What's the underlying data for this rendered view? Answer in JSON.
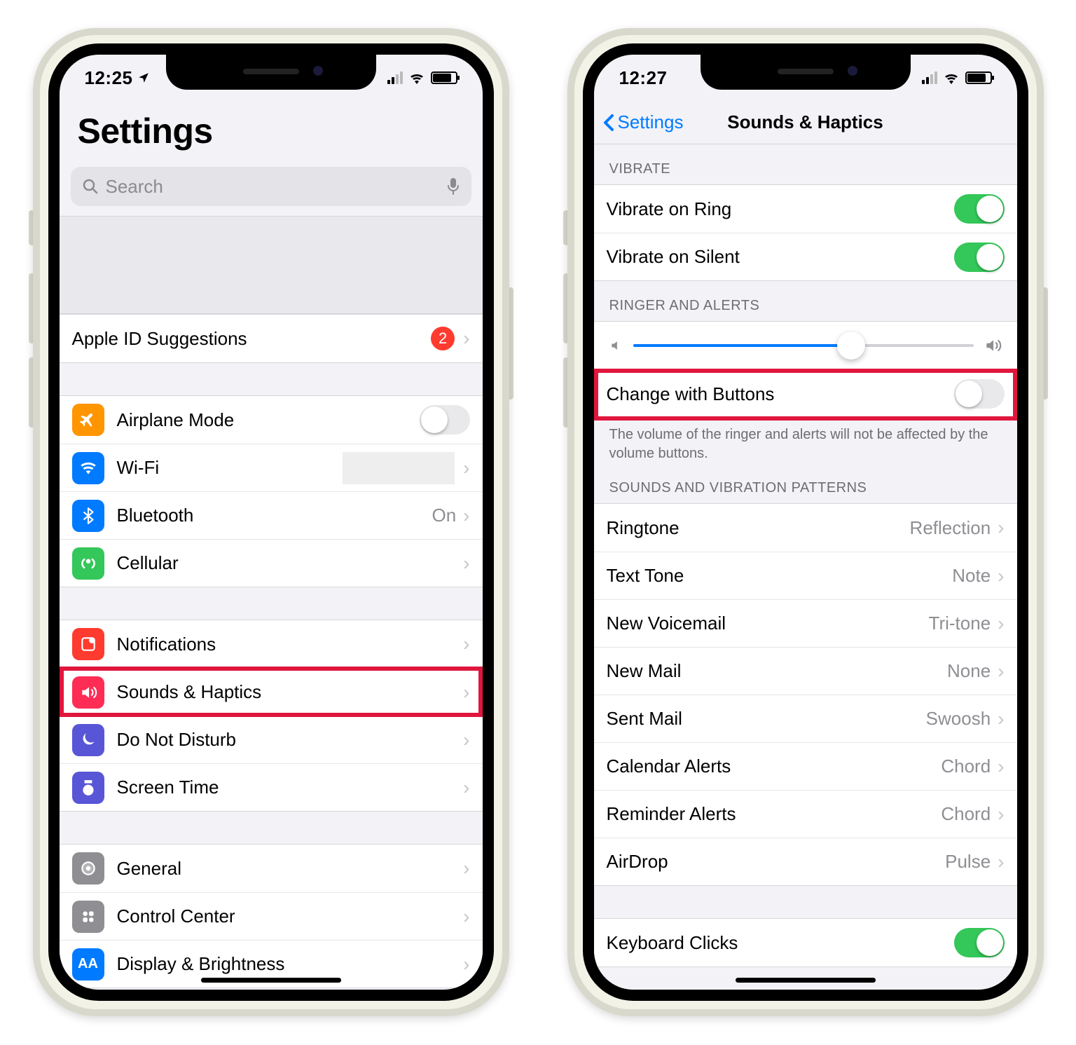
{
  "left": {
    "status_time": "12:25",
    "title": "Settings",
    "search_placeholder": "Search",
    "apple_id_row": {
      "label": "Apple ID Suggestions",
      "badge": "2"
    },
    "network": {
      "airplane": "Airplane Mode",
      "wifi": "Wi-Fi",
      "bluetooth": "Bluetooth",
      "bluetooth_value": "On",
      "cellular": "Cellular"
    },
    "system": {
      "notifications": "Notifications",
      "sounds": "Sounds & Haptics",
      "dnd": "Do Not Disturb",
      "screentime": "Screen Time"
    },
    "general_group": {
      "general": "General",
      "control_center": "Control Center",
      "display": "Display & Brightness"
    }
  },
  "right": {
    "status_time": "12:27",
    "back_label": "Settings",
    "nav_title": "Sounds & Haptics",
    "sections": {
      "vibrate": "VIBRATE",
      "ringer": "RINGER AND ALERTS",
      "patterns": "SOUNDS AND VIBRATION PATTERNS"
    },
    "vibrate_ring": "Vibrate on Ring",
    "vibrate_silent": "Vibrate on Silent",
    "change_buttons": "Change with Buttons",
    "change_footer": "The volume of the ringer and alerts will not be affected by the volume buttons.",
    "patterns_rows": {
      "ringtone": {
        "label": "Ringtone",
        "value": "Reflection"
      },
      "text": {
        "label": "Text Tone",
        "value": "Note"
      },
      "voicemail": {
        "label": "New Voicemail",
        "value": "Tri-tone"
      },
      "mail": {
        "label": "New Mail",
        "value": "None"
      },
      "sent": {
        "label": "Sent Mail",
        "value": "Swoosh"
      },
      "calendar": {
        "label": "Calendar Alerts",
        "value": "Chord"
      },
      "reminder": {
        "label": "Reminder Alerts",
        "value": "Chord"
      },
      "airdrop": {
        "label": "AirDrop",
        "value": "Pulse"
      }
    },
    "keyboard_clicks": "Keyboard Clicks",
    "slider_percent": 64
  }
}
